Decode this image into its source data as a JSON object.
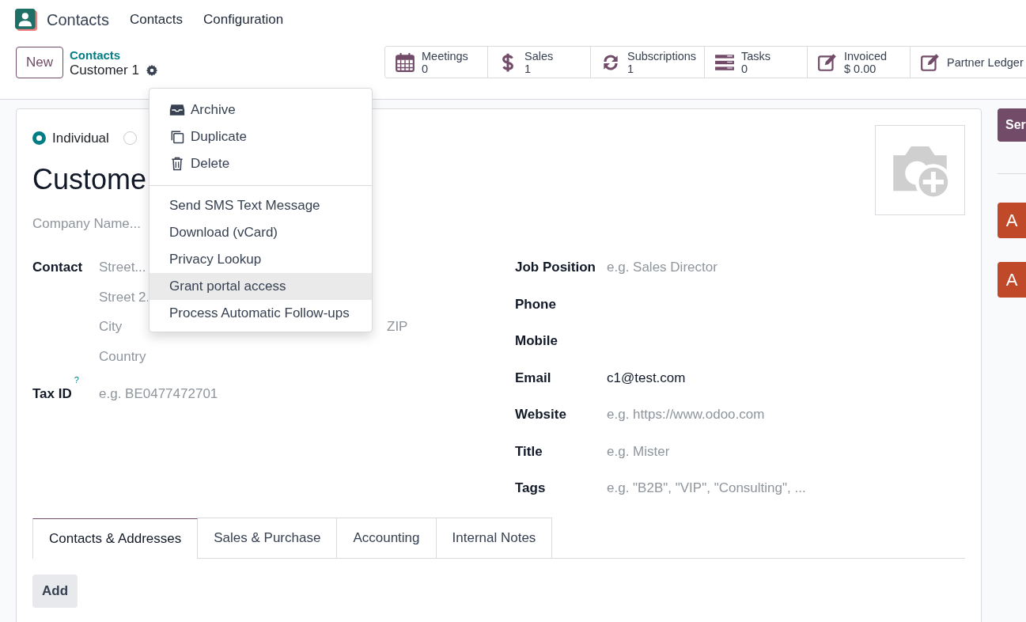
{
  "app": {
    "name": "Contacts"
  },
  "menu": [
    {
      "label": "Contacts"
    },
    {
      "label": "Configuration"
    }
  ],
  "control_panel": {
    "new_button": "New",
    "breadcrumb": "Contacts",
    "record_title": "Customer 1"
  },
  "stat_buttons": [
    {
      "kind": "calendar",
      "label": "Meetings",
      "value": "0"
    },
    {
      "kind": "dollar",
      "label": "Sales",
      "value": "1"
    },
    {
      "kind": "refresh",
      "label": "Subscriptions",
      "value": "1"
    },
    {
      "kind": "tasks",
      "label": "Tasks",
      "value": "0"
    },
    {
      "kind": "edit",
      "label": "Invoiced",
      "value": "$ 0.00"
    },
    {
      "kind": "edit",
      "label": "Partner Ledger"
    }
  ],
  "actions_menu": {
    "groups": [
      [
        {
          "kind": "archive",
          "label": "Archive",
          "highlighted": false
        },
        {
          "kind": "copy",
          "label": "Duplicate",
          "highlighted": false
        },
        {
          "kind": "trash",
          "label": "Delete",
          "highlighted": false
        }
      ],
      [
        {
          "kind": "text",
          "label": "Send SMS Text Message",
          "highlighted": false
        },
        {
          "kind": "text",
          "label": "Download (vCard)",
          "highlighted": false
        },
        {
          "kind": "text",
          "label": "Privacy Lookup",
          "highlighted": false
        },
        {
          "kind": "text",
          "label": "Grant portal access",
          "highlighted": true
        },
        {
          "kind": "text",
          "label": "Process Automatic Follow-ups",
          "highlighted": false
        }
      ]
    ]
  },
  "form": {
    "company_type": [
      {
        "label": "Individual",
        "selected": true
      },
      {
        "selected": false
      }
    ],
    "name": "Custome",
    "company_placeholder": "Company Name...",
    "address": {
      "label": "Contact",
      "street_placeholder": "Street...",
      "street2_placeholder": "Street 2.",
      "city_placeholder": "City",
      "zip_placeholder": "ZIP",
      "country_placeholder": "Country"
    },
    "tax_id": {
      "label": "Tax ID",
      "help": "?",
      "placeholder": "e.g. BE0477472701"
    },
    "right_fields": [
      {
        "label": "Job Position",
        "placeholder": "e.g. Sales Director"
      },
      {
        "label": "Phone"
      },
      {
        "label": "Mobile"
      },
      {
        "label": "Email",
        "value": "c1@test.com"
      },
      {
        "label": "Website",
        "placeholder": "e.g. https://www.odoo.com"
      },
      {
        "label": "Title",
        "placeholder": "e.g. Mister"
      },
      {
        "label": "Tags",
        "placeholder": "e.g. \"B2B\", \"VIP\", \"Consulting\", ..."
      }
    ],
    "tabs": [
      {
        "label": "Contacts & Addresses",
        "selected": true
      },
      {
        "label": "Sales & Purchase",
        "selected": false
      },
      {
        "label": "Accounting",
        "selected": false
      },
      {
        "label": "Internal Notes",
        "selected": false
      }
    ],
    "add_button": "Add"
  },
  "chatter": {
    "send_button": "Ser",
    "messages": [
      {
        "avatar": "A"
      },
      {
        "avatar": "A"
      }
    ]
  }
}
